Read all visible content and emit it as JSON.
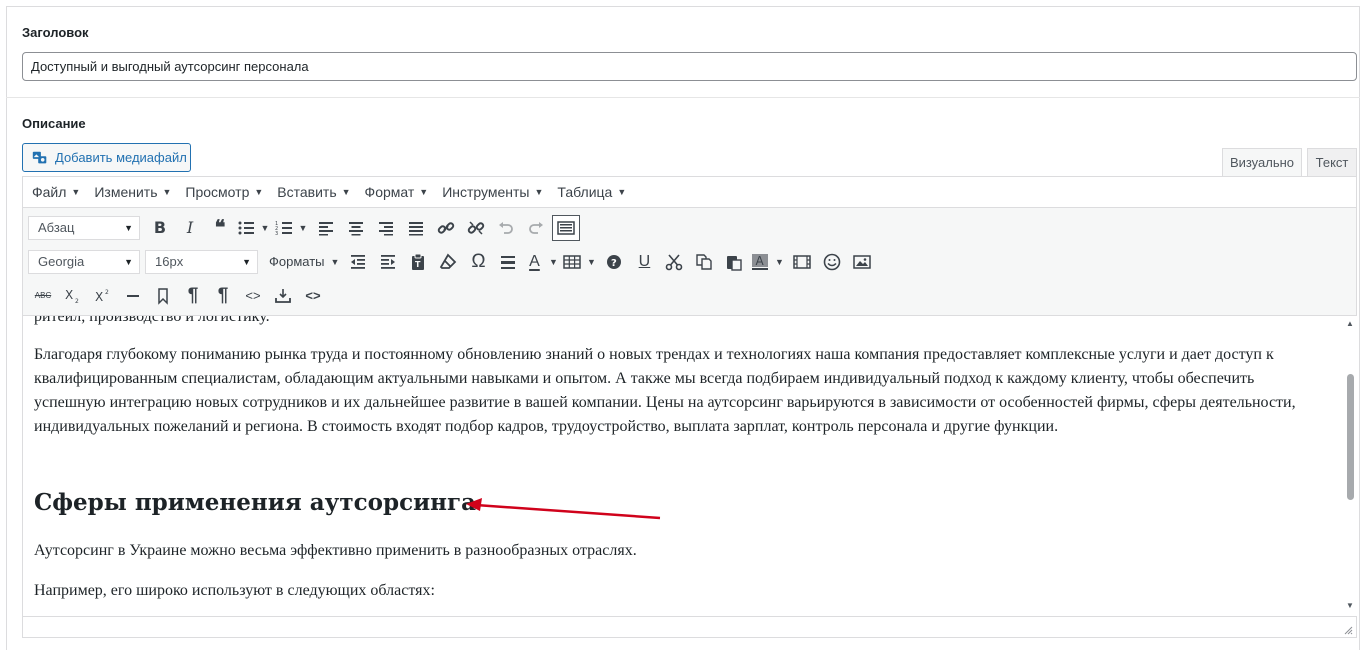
{
  "title_field": {
    "label": "Заголовок",
    "value": "Доступный и выгодный аутсорсинг персонала"
  },
  "description_field": {
    "label": "Описание"
  },
  "media_button": {
    "label": "Добавить медиафайл",
    "icon": "media-icon"
  },
  "editor_tabs": [
    {
      "label": "Визуально",
      "active": true
    },
    {
      "label": "Текст",
      "active": false
    }
  ],
  "menubar": [
    {
      "label": "Файл"
    },
    {
      "label": "Изменить"
    },
    {
      "label": "Просмотр"
    },
    {
      "label": "Вставить"
    },
    {
      "label": "Формат"
    },
    {
      "label": "Инструменты"
    },
    {
      "label": "Таблица"
    }
  ],
  "toolbar": {
    "block_format": "Абзац",
    "font_family": "Georgia",
    "font_size": "16px",
    "formats_label": "Форматы",
    "row1_icons": [
      "bold-icon",
      "italic-icon",
      "blockquote-icon",
      "bullet-list-icon",
      "numbered-list-icon",
      "align-left-icon",
      "align-center-icon",
      "align-right-icon",
      "align-justify-icon",
      "link-icon",
      "unlink-icon",
      "undo-icon",
      "redo-icon",
      "toolbar-toggle-icon"
    ],
    "row2_icons": [
      "outdent-icon",
      "indent-icon",
      "paste-text-icon",
      "clear-formatting-icon",
      "special-character-icon",
      "horizontal-line-icon",
      "text-color-icon",
      "table-icon",
      "help-icon",
      "underline-icon",
      "cut-icon",
      "copy-icon",
      "paste-icon",
      "background-color-icon",
      "media-embed-icon",
      "emoticons-icon",
      "image-icon"
    ],
    "row3_icons": [
      "strikethrough-icon",
      "subscript-icon",
      "superscript-icon",
      "horizontal-rule-icon",
      "anchor-icon",
      "paragraph-mark-icon",
      "show-blocks-icon",
      "code-icon",
      "insert-below-icon",
      "source-code-icon"
    ],
    "bold_glyph": "B",
    "italic_glyph": "I",
    "quote_glyph": "❝",
    "omega_glyph": "Ω",
    "underline_glyph": "U",
    "text_color_glyph": "A",
    "strike_glyph": "ABC",
    "pilcrow_glyph": "¶",
    "code_glyph": "<>"
  },
  "content": {
    "cut_line": "ритейл, производство и логистику.",
    "paragraph1": "Благодаря глубокому пониманию рынка труда и постоянному обновлению знаний о новых трендах и технологиях наша компания предоставляет комплексные услуги и дает доступ к квалифицированным специалистам, обладающим актуальными навыками и опытом. А также мы всегда подбираем индивидуальный подход к каждому клиенту, чтобы обеспечить успешную интеграцию новых сотрудников и их дальнейшее развитие в вашей компании. Цены на аутсорсинг варьируются в зависимости от особенностей фирмы, сферы деятельности, индивидуальных пожеланий и региона. В стоимость входят подбор кадров, трудоустройство, выплата зарплат, контроль персонала и другие функции.",
    "heading": "Сферы применения аутсорсинга",
    "paragraph2": "Аутсорсинг в Украине можно весьма эффективно применить в разнообразных отраслях.",
    "paragraph3": "Например, его широко используют в следующих областях:"
  },
  "colors": {
    "accent": "#2271b1",
    "annotation_arrow": "#d0021b",
    "border": "#dcdcde"
  },
  "scroll_position": 0.3
}
